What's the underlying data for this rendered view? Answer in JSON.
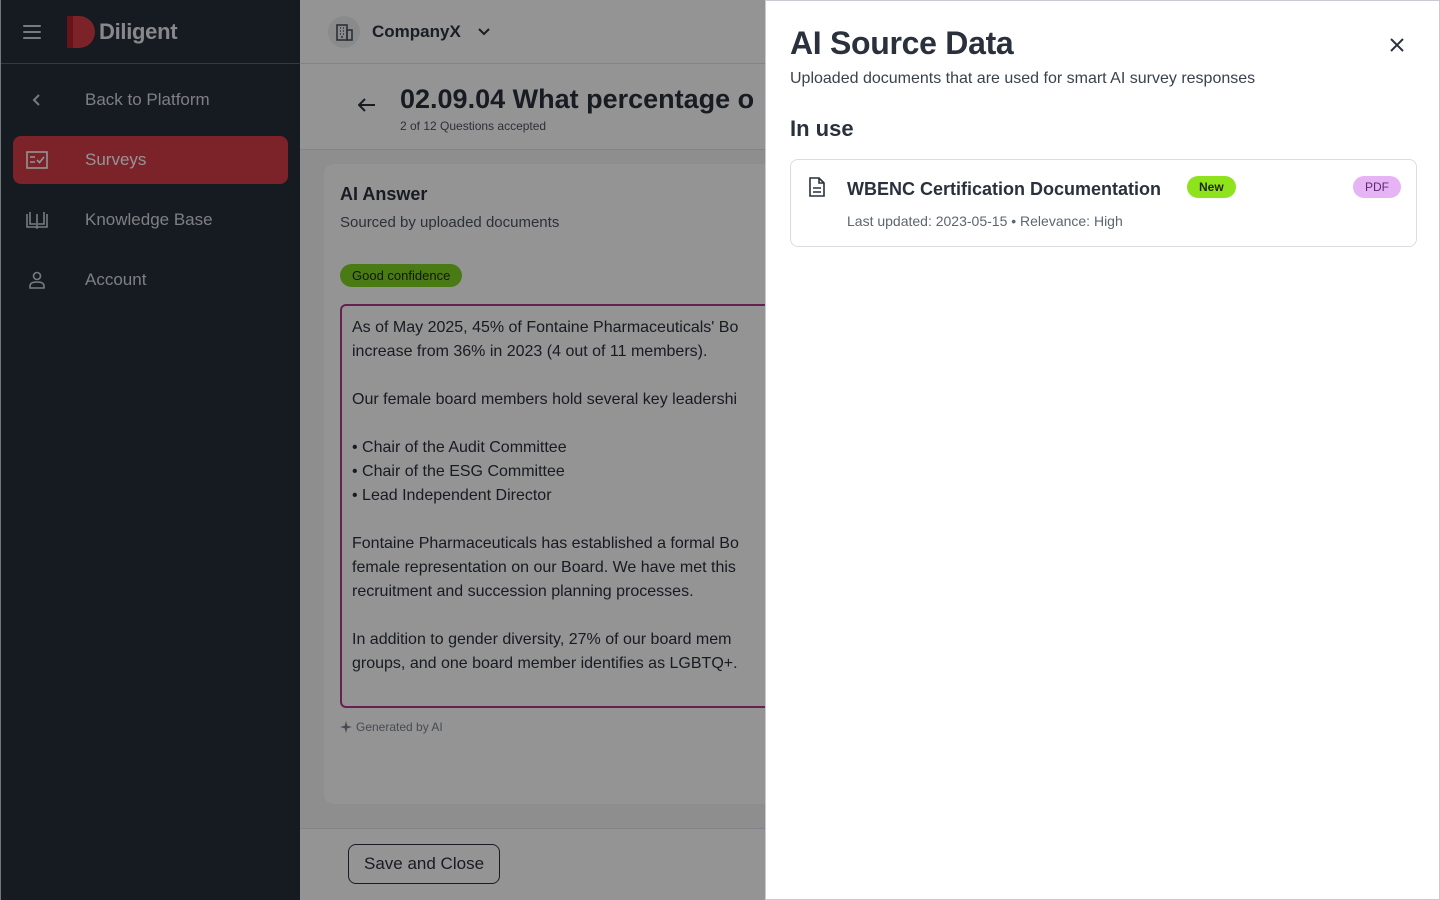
{
  "app": {
    "brand": "Diligent",
    "brand_color": "#d63c48"
  },
  "sidebar": {
    "items": [
      {
        "label": "Back to Platform",
        "icon": "chevron-left-icon"
      },
      {
        "label": "Surveys",
        "icon": "survey-checklist-icon",
        "active": true
      },
      {
        "label": "Knowledge Base",
        "icon": "book-icon"
      },
      {
        "label": "Account",
        "icon": "person-icon"
      }
    ]
  },
  "topbar": {
    "company": "CompanyX"
  },
  "question": {
    "title": "02.09.04 What percentage o",
    "progress": "2 of 12 Questions accepted"
  },
  "answer_card": {
    "title": "AI Answer",
    "subtitle": "Sourced by  uploaded documents",
    "confidence": "Good confidence",
    "lines": [
      "As of May 2025, 45% of Fontaine Pharmaceuticals' Bo",
      "increase from 36% in 2023 (4 out of 11 members).",
      "",
      "Our female board members hold several key leadershi",
      "",
      "• Chair of the Audit Committee",
      "• Chair of the ESG Committee",
      "• Lead Independent Director",
      "",
      "Fontaine Pharmaceuticals has established a formal Bo",
      "female representation on our Board. We have met this",
      "recruitment and succession planning processes.",
      "",
      "In addition to gender diversity, 27% of our board mem",
      "groups, and one board member identifies as LGBTQ+."
    ],
    "generated_label": "Generated by AI"
  },
  "footer": {
    "save_label": "Save and Close"
  },
  "drawer": {
    "title": "AI Source Data",
    "subtitle": "Uploaded documents that are used for smart AI survey responses",
    "section": "In use",
    "documents": [
      {
        "name": "WBENC Certification Documentation",
        "badge": "New",
        "type": "PDF",
        "meta": "Last updated: 2023-05-15 • Relevance: High"
      }
    ]
  }
}
